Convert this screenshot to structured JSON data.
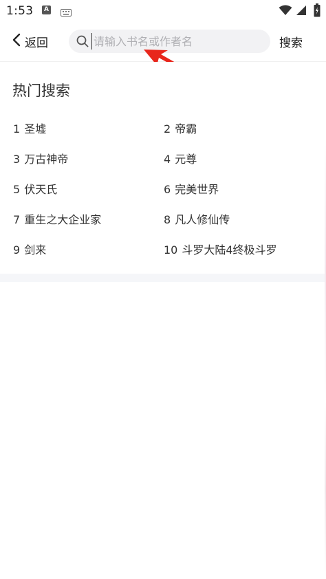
{
  "status_bar": {
    "time": "1:53",
    "a_badge": "A",
    "icons": [
      "a-badge-icon",
      "keyboard-icon",
      "wifi-icon",
      "cell-signal-icon",
      "battery-icon"
    ]
  },
  "header": {
    "back_label": "返回",
    "search_placeholder": "请输入书名或作者名",
    "search_value": "",
    "search_button_label": "搜索"
  },
  "hot_search": {
    "title": "热门搜索",
    "items": [
      {
        "rank": "1",
        "label": "圣墟"
      },
      {
        "rank": "2",
        "label": "帝霸"
      },
      {
        "rank": "3",
        "label": "万古神帝"
      },
      {
        "rank": "4",
        "label": "元尊"
      },
      {
        "rank": "5",
        "label": "伏天氏"
      },
      {
        "rank": "6",
        "label": "完美世界"
      },
      {
        "rank": "7",
        "label": "重生之大企业家"
      },
      {
        "rank": "8",
        "label": "凡人修仙传"
      },
      {
        "rank": "9",
        "label": "剑来"
      },
      {
        "rank": "10",
        "label": "斗罗大陆4终极斗罗"
      }
    ]
  },
  "colors": {
    "annotation_arrow": "#e8261c",
    "search_box_bg": "#f2f2f4",
    "divider": "#f5f6f9"
  }
}
